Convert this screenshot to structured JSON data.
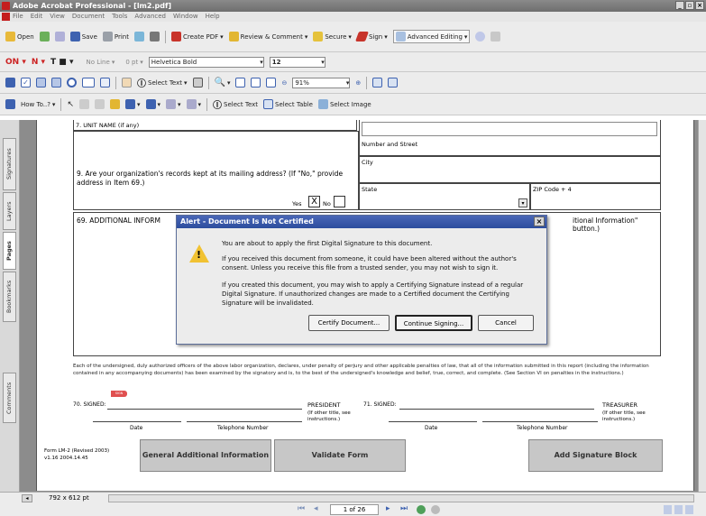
{
  "app": {
    "title": "Adobe Acrobat Professional - [lm2.pdf]",
    "menus": [
      "File",
      "Edit",
      "View",
      "Document",
      "Tools",
      "Advanced",
      "Window",
      "Help"
    ]
  },
  "toolbar1": {
    "open": "Open",
    "save": "Save",
    "print": "Print",
    "create_pdf": "Create PDF",
    "review": "Review & Comment",
    "secure": "Secure",
    "sign": "Sign",
    "advanced_editing": "Advanced Editing"
  },
  "toolbar2": {
    "no_line": "No Line",
    "line_width": "0 pt",
    "font_name": "Helvetica Bold",
    "font_size": "12"
  },
  "toolbar3": {
    "select_text": "Select Text",
    "zoom": "91%"
  },
  "toolbar4": {
    "how_to": "How To..?",
    "select_text": "Select Text",
    "select_table": "Select Table",
    "select_image": "Select Image"
  },
  "side_tabs": [
    "Signatures",
    "Layers",
    "Pages",
    "Bookmarks",
    "Comments"
  ],
  "form": {
    "unit_name": "7. UNIT NAME (if any)",
    "number_street": "Number and Street",
    "city": "City",
    "state": "State",
    "zip": "ZIP Code + 4",
    "q9": "9. Are your organization's records kept at its mailing address? (If \"No,\" provide address in Item 69.)",
    "yes": "Yes",
    "yes_mark": "X",
    "no": "No",
    "q69_left": "69. ADDITIONAL INFORM",
    "q69_right": "itional Information\" button.)",
    "declaration": "Each of the undersigned, duly authorized officers of the above labor organization, declares, under penalty of perjury and other applicable penalties of law, that all of the information submitted in this report (including the information contained in any accompanying documents) has been examined by the signatory and is, to the best of the undersigned's knowledge and belief, true, correct, and complete. (See Section VI on penalties in the instructions.)",
    "signed70": "70. SIGNED:",
    "sign_tag": "SIGN",
    "president": "PRESIDENT",
    "other_title": "(If other title, see instructions.)",
    "signed71": "71. SIGNED:",
    "treasurer": "TREASURER",
    "date": "Date",
    "telephone": "Telephone Number",
    "form_id": "Form LM-2 (Revised 2003)",
    "version": "v1.16 2004.14.45",
    "btn_general": "General Additional Information",
    "btn_validate": "Validate Form",
    "btn_add_sig": "Add Signature Block"
  },
  "dialog": {
    "title": "Alert - Document Is Not Certified",
    "line1": "You are about to apply the first Digital Signature to this document.",
    "para2": "If you received this document from someone, it could have been altered without the author's consent. Unless you receive this file from a trusted sender, you may not wish to sign it.",
    "para3": "If you created this document, you may wish to apply a Certifying Signature instead of a regular Digital Signature. If unauthorized changes are made to a Certified document the Certifying Signature will be invalidated.",
    "certify": "Certify Document...",
    "continue": "Continue Signing...",
    "cancel": "Cancel"
  },
  "status": {
    "page_size": "792 x 612 pt",
    "page_indicator": "1 of 26"
  }
}
